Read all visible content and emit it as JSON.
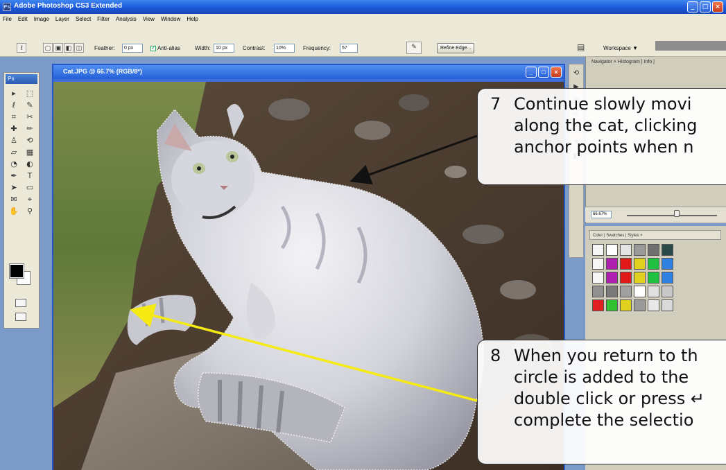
{
  "app": {
    "title": "Adobe Photoshop CS3 Extended",
    "ps_icon": "Ps",
    "window_buttons": [
      "_",
      "□",
      "×"
    ]
  },
  "menu": [
    "File",
    "Edit",
    "Image",
    "Layer",
    "Select",
    "Filter",
    "Analysis",
    "View",
    "Window",
    "Help"
  ],
  "options": {
    "feather_label": "Feather:",
    "feather_value": "0 px",
    "antialias_label": "Anti-alias",
    "width_label": "Width:",
    "width_value": "10 px",
    "contrast_label": "Contrast:",
    "contrast_value": "10%",
    "frequency_label": "Frequency:",
    "frequency_value": "57",
    "refine_edge_label": "Refine Edge...",
    "workspace_label": "Workspace ▼"
  },
  "tools_panel": {
    "logo": "Ps",
    "icons": [
      "move-icon",
      "marquee-icon",
      "lasso-icon",
      "quick-select-icon",
      "crop-icon",
      "slice-icon",
      "healing-icon",
      "brush-icon",
      "stamp-icon",
      "history-brush-icon",
      "eraser-icon",
      "gradient-icon",
      "blur-icon",
      "dodge-icon",
      "pen-icon",
      "type-icon",
      "path-select-icon",
      "shape-icon",
      "notes-icon",
      "eyedropper-icon",
      "hand-icon",
      "zoom-icon"
    ],
    "glyphs": [
      "▸",
      "⬚",
      "ℓ",
      "✎",
      "⌗",
      "✂",
      "✚",
      "✏",
      "♙",
      "⟲",
      "▱",
      "▦",
      "◔",
      "◐",
      "✒",
      "T",
      "➤",
      "▭",
      "✉",
      "⌖",
      "✋",
      "⚲"
    ]
  },
  "document": {
    "title": "Cat.JPG @ 66.7% (RGB/8*)",
    "window_buttons": [
      "_",
      "□",
      "×"
    ]
  },
  "panels": {
    "navigator_tabs": "Navigator × Histogram | Info |",
    "zoom_value": "66.67%",
    "styles_tabs": "Color | Swatches | Styles ×",
    "style_swatches": [
      "#f6f6f6",
      "#ffffff",
      "#e4e4e4",
      "#9a9a9a",
      "#707070",
      "#2a4a4a",
      "#f6f6f6",
      "#b020b0",
      "#e01818",
      "#e0d020",
      "#20c040",
      "#3080e0",
      "#f6f6f6",
      "#b020b0",
      "#e01818",
      "#e0d020",
      "#20c040",
      "#3080e0",
      "#909090",
      "#7a7a7a",
      "#a0a0a0",
      "#ffffff",
      "#e0e0e0",
      "#c8c8c8",
      "#e02020",
      "#30c030",
      "#e0d020",
      "#9a9a9a",
      "#e8e8e8",
      "#dadada"
    ]
  },
  "callouts": [
    {
      "number": "7",
      "lines": [
        "Continue slowly movi",
        "along the cat, clicking",
        "anchor points when n"
      ]
    },
    {
      "number": "8",
      "lines": [
        "When you return to th",
        "circle is added to the",
        "double click or press ↵",
        "complete the selectio"
      ]
    }
  ],
  "colors": {
    "titlebar": "#2a66e0",
    "arrow_black": "#111111",
    "arrow_yellow": "#f5ea14"
  }
}
